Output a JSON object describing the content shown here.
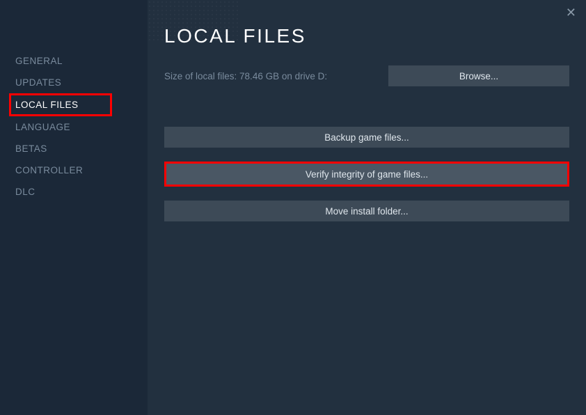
{
  "sidebar": {
    "items": [
      {
        "label": "GENERAL"
      },
      {
        "label": "UPDATES"
      },
      {
        "label": "LOCAL FILES"
      },
      {
        "label": "LANGUAGE"
      },
      {
        "label": "BETAS"
      },
      {
        "label": "CONTROLLER"
      },
      {
        "label": "DLC"
      }
    ]
  },
  "main": {
    "title": "LOCAL FILES",
    "size_label": "Size of local files: 78.46 GB on drive D:",
    "browse_label": "Browse...",
    "backup_label": "Backup game files...",
    "verify_label": "Verify integrity of game files...",
    "move_label": "Move install folder...",
    "close_icon": "✕"
  }
}
